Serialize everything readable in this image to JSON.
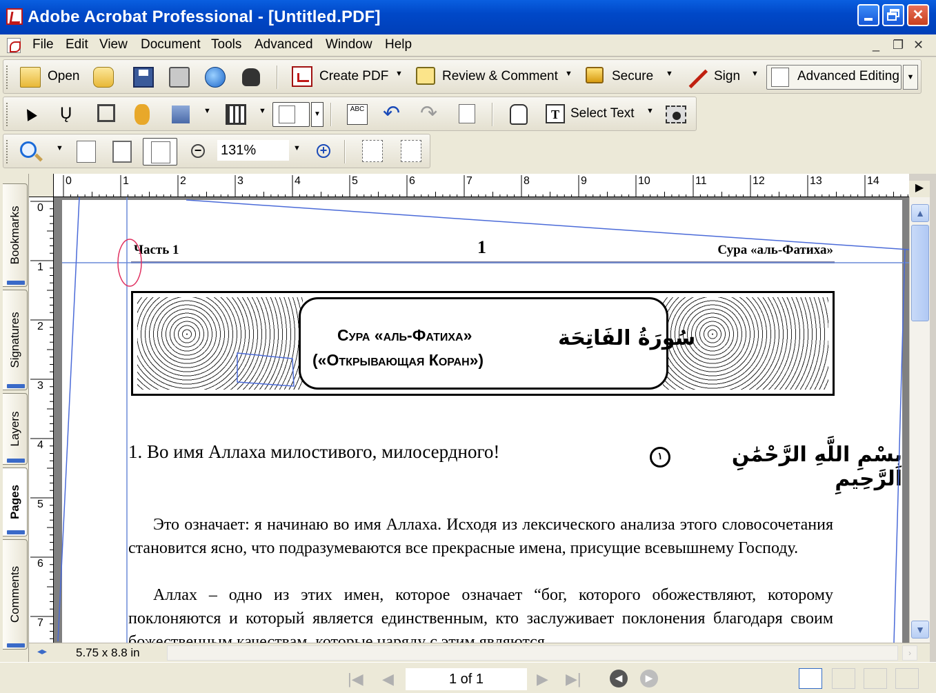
{
  "window": {
    "title": "Adobe Acrobat Professional - [Untitled.PDF]"
  },
  "menu": [
    "File",
    "Edit",
    "View",
    "Document",
    "Tools",
    "Advanced",
    "Window",
    "Help"
  ],
  "toolbar1": {
    "open": "Open",
    "create_pdf": "Create PDF",
    "review": "Review & Comment",
    "secure": "Secure",
    "sign": "Sign",
    "advanced_editing": "Advanced Editing"
  },
  "toolbar2": {
    "select_text": "Select Text"
  },
  "toolbar3": {
    "zoom": "131%"
  },
  "nav_tabs": [
    "Bookmarks",
    "Signatures",
    "Layers",
    "Pages",
    "Comments"
  ],
  "hruler_ticks": [
    "0",
    "1",
    "2",
    "3",
    "4",
    "5",
    "6",
    "7",
    "8",
    "9",
    "10",
    "11",
    "12",
    "13",
    "14"
  ],
  "vruler_ticks": [
    "0",
    "1",
    "2",
    "3",
    "4",
    "5",
    "6",
    "7"
  ],
  "document": {
    "running_left": "Часть 1",
    "page_number": "1",
    "running_right": "Сура «аль-Фатиха»",
    "sura_title_1": "Сура «аль-Фатиха»",
    "sura_title_2": "(«Открывающая Коран»)",
    "sura_arabic": "سُورَةُ الفَاتِحَة",
    "verse1": "1. Во имя Аллаха милостивого, милосердного!",
    "verse1_arabic": "بِسْمِ اللَّهِ الرَّحْمَٰنِ الرَّحِيمِ",
    "ayah_number": "١",
    "para1": "Это означает: я начинаю во имя Аллаха. Исходя из лексического анализа этого словосочетания становится ясно, что подразумеваются все прекрасные имена, присущие всевышнему Господу.",
    "para2": "Аллах – одно из этих имен, которое означает “бог, которого обожествляют, которому поклоняются и который является единственным, кто заслуживает поклонения благодаря своим божественным качествам, которые наряду с этим являются"
  },
  "status": {
    "page_size": "5.75 x 8.8 in",
    "page_indicator": "1 of 1"
  }
}
